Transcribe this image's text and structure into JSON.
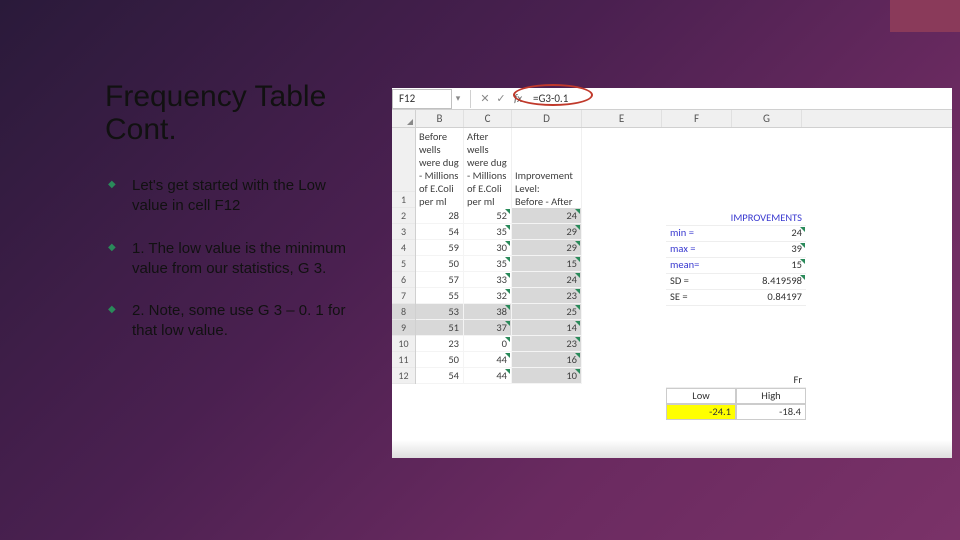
{
  "slide": {
    "title": "Frequency Table Cont.",
    "bullets": [
      "Let's get started with the Low value in cell F12",
      "1.  The low value is the minimum value from our statistics, G 3.",
      "2. Note, some use G 3 – 0. 1 for that low value."
    ]
  },
  "excel": {
    "name_box": "F12",
    "formula": "=G3-0.1",
    "columns": [
      "B",
      "C",
      "D",
      "E",
      "F",
      "G"
    ],
    "header_row1": {
      "B": "Before",
      "C": "After"
    },
    "header_row2": {
      "B": "wells",
      "C": "wells"
    },
    "header_row3": {
      "B": "were dug",
      "C": "were dug"
    },
    "header_row4": {
      "B": "- Millions",
      "C": "- Millions",
      "D": "Improvement"
    },
    "header_row5": {
      "B": "of E.Coli",
      "C": "of E.Coli",
      "D": "Level:"
    },
    "header_row6": {
      "B": "per ml",
      "C": "per ml",
      "D": "Before - After",
      "row_label": "1"
    },
    "rows": [
      {
        "n": "2",
        "B": "28",
        "C": "52",
        "D": "24"
      },
      {
        "n": "3",
        "B": "54",
        "C": "35",
        "D": "29"
      },
      {
        "n": "4",
        "B": "59",
        "C": "30",
        "D": "29"
      },
      {
        "n": "5",
        "B": "50",
        "C": "35",
        "D": "15"
      },
      {
        "n": "6",
        "B": "57",
        "C": "33",
        "D": "24"
      },
      {
        "n": "7",
        "B": "55",
        "C": "32",
        "D": "23"
      },
      {
        "n": "8",
        "B": "53",
        "C": "38",
        "D": "25"
      },
      {
        "n": "9",
        "B": "51",
        "C": "37",
        "D": "14"
      },
      {
        "n": "10",
        "B": "23",
        "C": "0",
        "D": "23"
      },
      {
        "n": "11",
        "B": "50",
        "C": "44",
        "D": "16"
      },
      {
        "n": "12",
        "B": "54",
        "C": "44",
        "D": "10"
      }
    ],
    "stats": {
      "title": "IMPROVEMENTS",
      "items": [
        {
          "label": "min =",
          "val": "24"
        },
        {
          "label": "max =",
          "val": "39"
        },
        {
          "label": "mean=",
          "val": "15"
        },
        {
          "label": "SD =",
          "val": "8.419598"
        },
        {
          "label": "SE =",
          "val": "0.84197"
        }
      ]
    },
    "lowhigh": {
      "fr_label": "Fr",
      "low_label": "Low",
      "high_label": "High",
      "low_val": "-24.1",
      "high_val": "-18.4"
    }
  }
}
